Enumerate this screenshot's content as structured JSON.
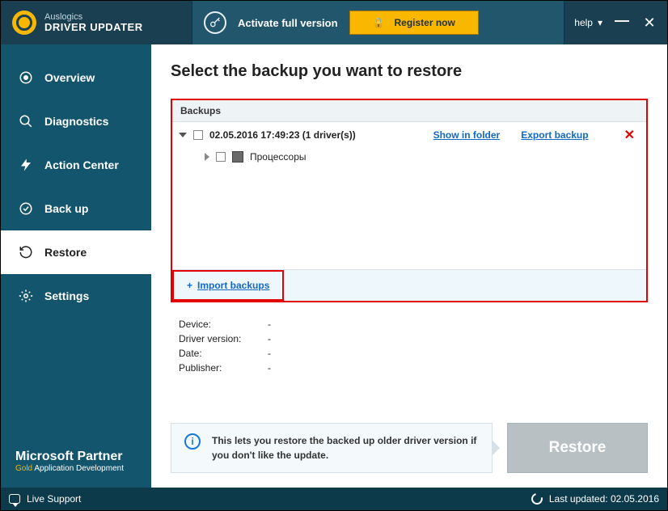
{
  "header": {
    "brand": "Auslogics",
    "product": "DRIVER UPDATER",
    "activate_label": "Activate full version",
    "register_label": "Register now",
    "help_label": "help"
  },
  "sidebar": {
    "items": [
      {
        "label": "Overview"
      },
      {
        "label": "Diagnostics"
      },
      {
        "label": "Action Center"
      },
      {
        "label": "Back up"
      },
      {
        "label": "Restore"
      },
      {
        "label": "Settings"
      }
    ],
    "partner_line1": "Microsoft Partner",
    "partner_gold": "Gold",
    "partner_rest": " Application Development"
  },
  "main": {
    "title": "Select the backup you want to restore",
    "backups_header": "Backups",
    "backup_entry": {
      "label": "02.05.2016 17:49:23 (1 driver(s))",
      "show_in_folder": "Show in folder",
      "export_backup": "Export backup",
      "child_label": "Процессоры"
    },
    "import_label": "Import backups",
    "details": {
      "device_k": "Device:",
      "device_v": "-",
      "version_k": "Driver version:",
      "version_v": "-",
      "date_k": "Date:",
      "date_v": "-",
      "publisher_k": "Publisher:",
      "publisher_v": "-"
    },
    "info_text": "This lets you restore the backed up older driver version if you don't like the update.",
    "restore_btn": "Restore"
  },
  "status": {
    "live": "Live Support",
    "last_updated_label": "Last updated: ",
    "last_updated_value": "02.05.2016"
  }
}
